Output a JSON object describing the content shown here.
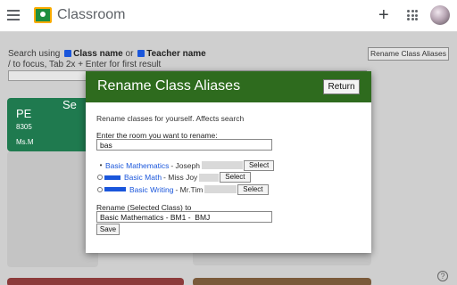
{
  "appbar": {
    "title": "Classroom",
    "icons": [
      "menu-icon",
      "classroom-logo-icon",
      "plus-icon",
      "apps-grid-icon",
      "avatar"
    ],
    "plus_glyph": "+"
  },
  "background": {
    "search_using_label": "Search using",
    "class_name_label": "Class name",
    "or_label": "or",
    "teacher_name_label": "Teacher name",
    "hint": "/ to focus, Tab 2x + Enter for first result",
    "rename_aliases_button": "Rename Class Aliases",
    "cards": [
      {
        "title": "PE",
        "section": "8305",
        "teacher": "Ms.M",
        "color": "#1f7a4f"
      },
      {
        "title": "Se"
      }
    ],
    "help_glyph": "?"
  },
  "modal": {
    "title": "Rename Class Aliases",
    "return_button": "Return",
    "description": "Rename classes for yourself. Affects search",
    "find_label": "Enter the room you want to rename:",
    "find_value": "bas",
    "results": [
      {
        "marker": "bullet",
        "class_name": "Basic Mathematics",
        "teacher": "- Joseph",
        "select_label": "Select"
      },
      {
        "marker": "radio",
        "class_name": "Basic Math",
        "teacher": "- Miss Joy",
        "select_label": "Select"
      },
      {
        "marker": "radio",
        "class_name": "Basic Writing",
        "teacher": "- Mr.Tim",
        "select_label": "Select"
      }
    ],
    "rename_label": "Rename (Selected Class) to",
    "rename_value": "Basic Mathematics - BM1 -  BMJ",
    "save_button": "Save",
    "header_color": "#2e6b1e",
    "link_color": "#1a56db"
  }
}
